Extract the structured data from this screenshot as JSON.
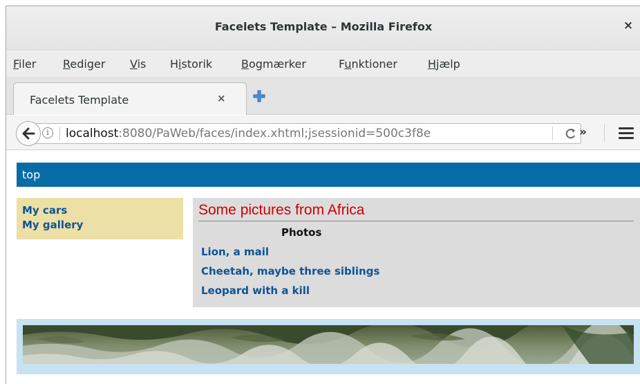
{
  "window": {
    "title": "Facelets Template – Mozilla Firefox",
    "close": "×"
  },
  "menu": {
    "items": [
      {
        "label": "Filer",
        "mnemonic_index": 0
      },
      {
        "label": "Rediger",
        "mnemonic_index": 0
      },
      {
        "label": "Vis",
        "mnemonic_index": 0
      },
      {
        "label": "Historik",
        "mnemonic_index": 1
      },
      {
        "label": "Bogmærker",
        "mnemonic_index": 0
      },
      {
        "label": "Funktioner",
        "mnemonic_index": 1
      },
      {
        "label": "Hjælp",
        "mnemonic_index": 0
      }
    ]
  },
  "tabs": [
    {
      "label": "Facelets Template",
      "close": "×"
    }
  ],
  "navbar": {
    "url_host": "localhost",
    "url_rest": ":8080/PaWeb/faces/index.xhtml;jsessionid=500c3f8e",
    "info": "i",
    "reload": "C",
    "overflow": "»"
  },
  "page": {
    "top_label": "top",
    "left_nav": [
      "My cars",
      "My gallery"
    ],
    "heading": "Some pictures from Africa",
    "photos_label": "Photos",
    "photo_links": [
      "Lion, a mail",
      "Cheetah, maybe three siblings",
      "Leopard with a kill"
    ]
  },
  "colors": {
    "top_bar": "#086da7",
    "left_nav_bg": "#ede0a6",
    "content_bg": "#dcdcdc",
    "heading": "#cc0000",
    "link": "#0f5395",
    "footer_bg": "#c7e2f1"
  },
  "icons": [
    "back-arrow-icon",
    "info-icon",
    "reload-icon",
    "overflow-chevron-icon",
    "hamburger-menu-icon",
    "new-tab-plus-icon",
    "close-icon"
  ]
}
